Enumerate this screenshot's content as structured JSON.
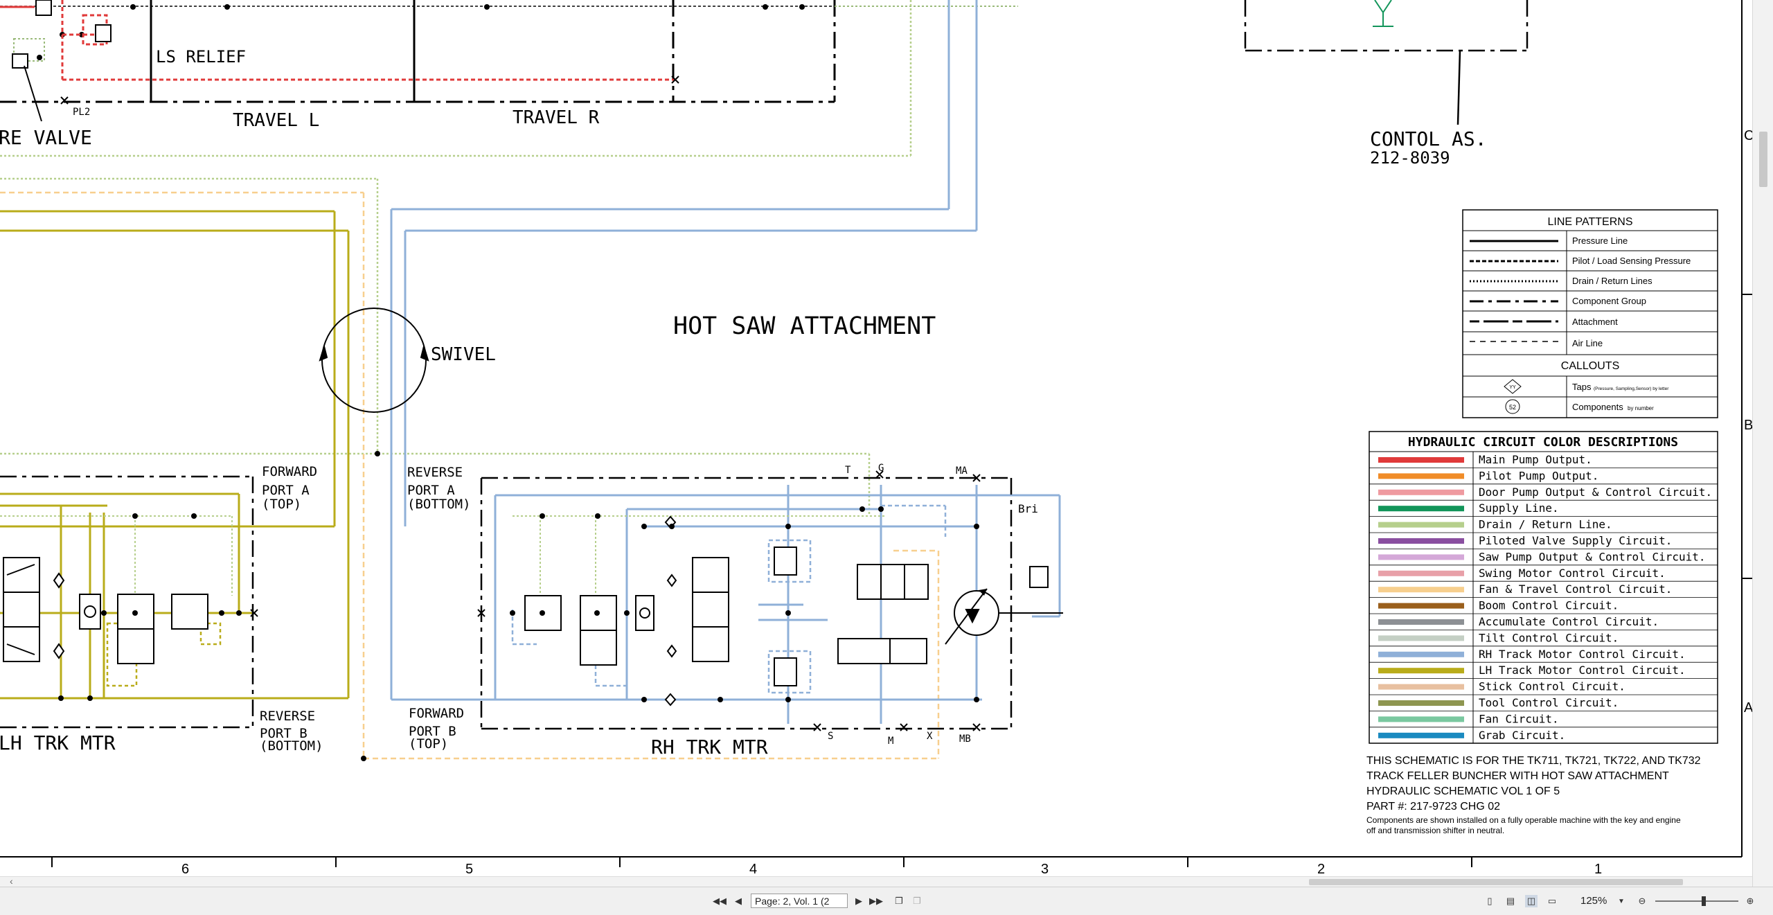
{
  "diagram": {
    "title": "HOT SAW ATTACHMENT",
    "labels": {
      "relief_valve": "RE VALVE",
      "ls_relief": "LS RELIEF",
      "pl2": "PL2",
      "travel_l": "TRAVEL L",
      "travel_r": "TRAVEL R",
      "control_as": "CONTOL AS.",
      "control_part": "212-8039",
      "swivel": "SWIVEL",
      "fwd_port_a_1": "FORWARD",
      "fwd_port_a_2": "PORT A",
      "fwd_port_a_3": "(TOP)",
      "rev_port_a_1": "REVERSE",
      "rev_port_a_2": "PORT A",
      "rev_port_a_3": "(BOTTOM)",
      "rev_port_b_1": "REVERSE",
      "rev_port_b_2": "PORT B",
      "rev_port_b_3": "(BOTTOM)",
      "fwd_port_b_1": "FORWARD",
      "fwd_port_b_2": "PORT B",
      "fwd_port_b_3": "(TOP)",
      "lh_trk_mtr": "LH TRK MTR",
      "rh_trk_mtr": "RH TRK MTR",
      "tap_t": "T",
      "tap_g": "G",
      "tap_ma": "MA",
      "tap_mb": "MB",
      "tap_s": "S",
      "tap_m": "M",
      "tap_x": "X",
      "bri": "Bri"
    },
    "grid": {
      "columns": [
        "6",
        "5",
        "4",
        "3",
        "2",
        "1"
      ],
      "rows": [
        "C",
        "B",
        "A"
      ]
    }
  },
  "line_patterns": {
    "title": "LINE PATTERNS",
    "items": [
      {
        "label": "Pressure Line"
      },
      {
        "label": "Pilot / Load Sensing Pressure"
      },
      {
        "label": "Drain / Return Lines"
      },
      {
        "label": "Component Group"
      },
      {
        "label": "Attachment"
      },
      {
        "label": "Air Line"
      }
    ],
    "callouts_title": "CALLOUTS",
    "callouts": [
      {
        "symbol": "YY",
        "label": "Taps",
        "note": "(Pressure, Sampling,Sensor) by letter"
      },
      {
        "symbol": "52",
        "label": "Components",
        "note": "by number"
      }
    ]
  },
  "color_descriptions": {
    "title": "HYDRAULIC CIRCUIT COLOR DESCRIPTIONS",
    "items": [
      {
        "color": "#e03a3a",
        "label": "Main Pump Output."
      },
      {
        "color": "#f08c28",
        "label": "Pilot Pump Output."
      },
      {
        "color": "#ef9aa0",
        "label": "Door Pump Output & Control Circuit."
      },
      {
        "color": "#12955a",
        "label": "Supply Line."
      },
      {
        "color": "#b6cf8c",
        "label": "Drain / Return Line."
      },
      {
        "color": "#8a4fa0",
        "label": "Piloted Valve Supply Circuit."
      },
      {
        "color": "#d4a8d8",
        "label": "Saw Pump Output & Control Circuit."
      },
      {
        "color": "#e8a0a8",
        "label": "Swing Motor Control Circuit."
      },
      {
        "color": "#f7cf8e",
        "label": "Fan & Travel Control Circuit."
      },
      {
        "color": "#9a5f1c",
        "label": "Boom Control Circuit."
      },
      {
        "color": "#8d9094",
        "label": "Accumulate Control Circuit."
      },
      {
        "color": "#c4cfc4",
        "label": "Tilt Control Circuit."
      },
      {
        "color": "#8fb0d8",
        "label": "RH Track Motor Control Circuit."
      },
      {
        "color": "#b9ac1a",
        "label": "LH Track Motor Control Circuit."
      },
      {
        "color": "#e8c0a0",
        "label": "Stick Control Circuit."
      },
      {
        "color": "#8e9650",
        "label": "Tool Control Circuit."
      },
      {
        "color": "#7ac8a0",
        "label": "Fan Circuit."
      },
      {
        "color": "#1a8ac0",
        "label": "Grab Circuit."
      }
    ]
  },
  "notes": {
    "line1": "THIS SCHEMATIC IS FOR THE TK711, TK721, TK722, AND TK732",
    "line2": "TRACK FELLER BUNCHER WITH HOT SAW ATTACHMENT",
    "line3": "HYDRAULIC SCHEMATIC VOL 1 OF 5",
    "line4": "PART #: 217-9723 CHG 02",
    "line5": "Components are shown installed on a fully operable machine with the key and engine",
    "line6": "off and transmission shifter in neutral."
  },
  "statusbar": {
    "page_field": "Page: 2, Vol. 1 (2",
    "zoom": "125%",
    "icons": [
      "first-page-icon",
      "prev-page-icon",
      "next-page-icon",
      "last-page-icon",
      "copy-icon",
      "paste-icon",
      "single-page-icon",
      "continuous-icon",
      "two-page-icon",
      "book-view-icon",
      "zoom-out-icon",
      "zoom-in-icon"
    ]
  },
  "colors": {
    "lh_track": "#b9ac1a",
    "rh_track": "#8fb0d8",
    "drain": "#b6cf8c",
    "fan_travel": "#f7cf8e",
    "main_pump": "#e03a3a",
    "supply": "#12955a"
  }
}
